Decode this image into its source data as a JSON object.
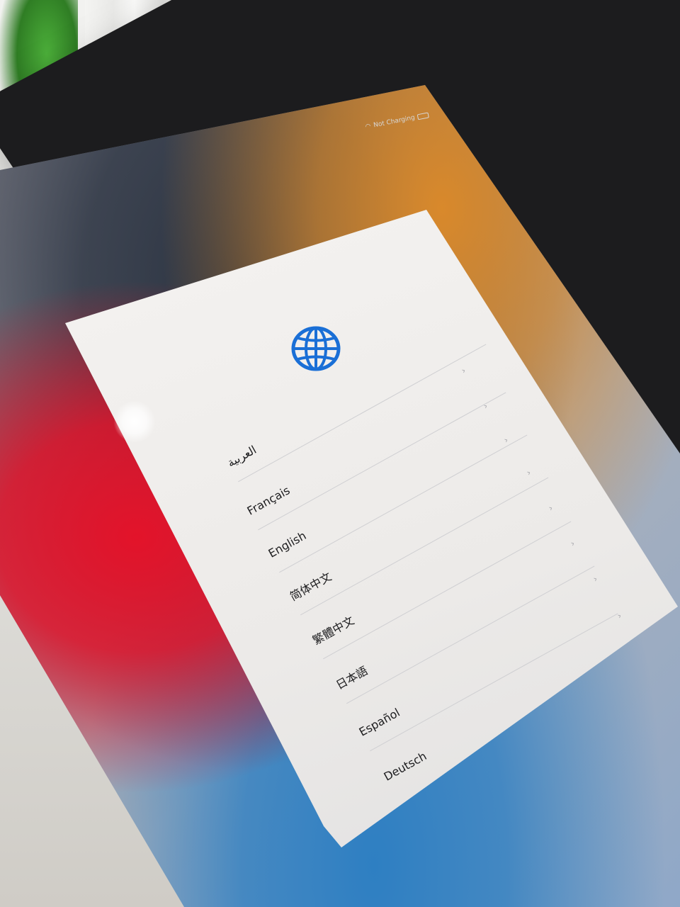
{
  "status_bar": {
    "text": "Not Charging"
  },
  "setup": {
    "icon": "globe-icon",
    "accent_color": "#1a6fd6",
    "languages": [
      {
        "label": "العربية"
      },
      {
        "label": "Français"
      },
      {
        "label": "English"
      },
      {
        "label": "简体中文"
      },
      {
        "label": "繁體中文"
      },
      {
        "label": "日本語"
      },
      {
        "label": "Español"
      },
      {
        "label": "Deutsch"
      }
    ],
    "chevron": "›"
  }
}
